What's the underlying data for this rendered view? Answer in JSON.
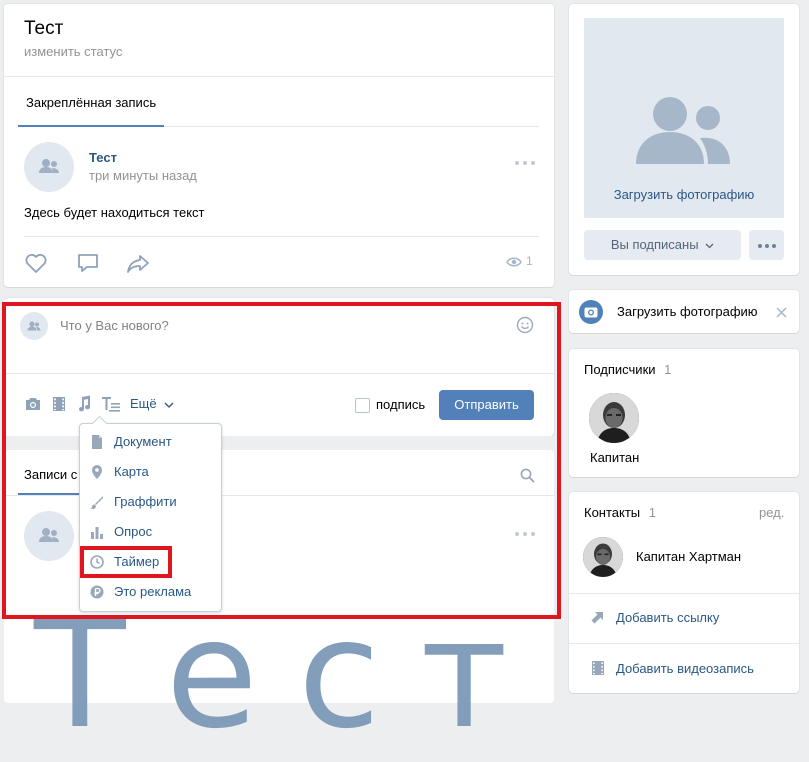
{
  "profile": {
    "name": "Тест",
    "status_link": "изменить статус"
  },
  "pinned": {
    "tab_label": "Закреплённая запись",
    "author": "Тест",
    "time": "три минуты назад",
    "text": "Здесь будет находиться текст",
    "views": "1"
  },
  "composer": {
    "placeholder": "Что у Вас нового?",
    "more_label": "Ещё",
    "signature_label": "подпись",
    "submit_label": "Отправить"
  },
  "more_menu": {
    "items": [
      {
        "label": "Документ",
        "icon": "document-icon"
      },
      {
        "label": "Карта",
        "icon": "map-pin-icon"
      },
      {
        "label": "Граффити",
        "icon": "brush-icon"
      },
      {
        "label": "Опрос",
        "icon": "poll-icon"
      },
      {
        "label": "Таймер",
        "icon": "clock-icon"
      },
      {
        "label": "Это реклама",
        "icon": "ruble-icon"
      }
    ]
  },
  "wall": {
    "tab_label": "Записи с"
  },
  "drawing_text": "Тест",
  "photo_block": {
    "upload_label": "Загрузить фотографию",
    "subscribed_label": "Вы подписаны",
    "more_dots": "•••"
  },
  "upload_banner": {
    "label": "Загрузить фотографию"
  },
  "subscribers": {
    "title": "Подписчики",
    "count": "1",
    "person_name": "Капитан"
  },
  "contacts": {
    "title": "Контакты",
    "count": "1",
    "edit_label": "ред.",
    "person_name": "Капитан Хартман",
    "add_link_label": "Добавить ссылку",
    "add_video_label": "Добавить видеозапись"
  },
  "colors": {
    "accent": "#5181b8",
    "link": "#2a5885",
    "highlight_red": "#e0161f",
    "drawing": "#7c99b8"
  }
}
